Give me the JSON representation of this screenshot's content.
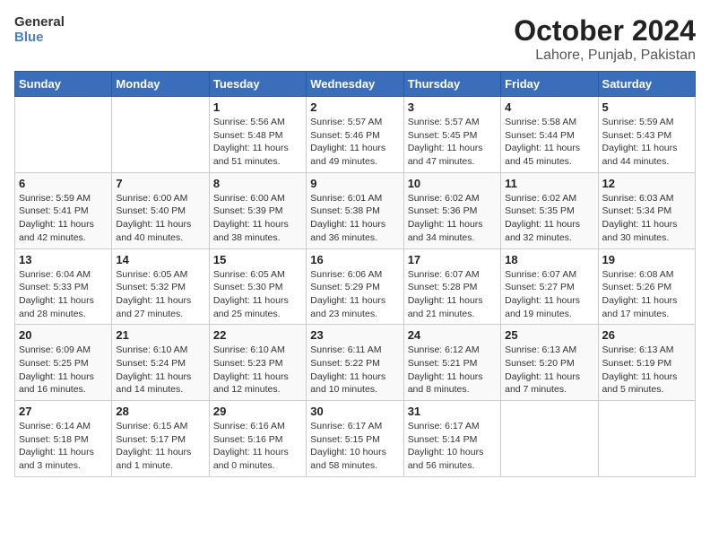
{
  "header": {
    "logo_line1": "General",
    "logo_line2": "Blue",
    "title": "October 2024",
    "subtitle": "Lahore, Punjab, Pakistan"
  },
  "weekdays": [
    "Sunday",
    "Monday",
    "Tuesday",
    "Wednesday",
    "Thursday",
    "Friday",
    "Saturday"
  ],
  "weeks": [
    [
      {
        "day": "",
        "info": ""
      },
      {
        "day": "",
        "info": ""
      },
      {
        "day": "1",
        "info": "Sunrise: 5:56 AM\nSunset: 5:48 PM\nDaylight: 11 hours and 51 minutes."
      },
      {
        "day": "2",
        "info": "Sunrise: 5:57 AM\nSunset: 5:46 PM\nDaylight: 11 hours and 49 minutes."
      },
      {
        "day": "3",
        "info": "Sunrise: 5:57 AM\nSunset: 5:45 PM\nDaylight: 11 hours and 47 minutes."
      },
      {
        "day": "4",
        "info": "Sunrise: 5:58 AM\nSunset: 5:44 PM\nDaylight: 11 hours and 45 minutes."
      },
      {
        "day": "5",
        "info": "Sunrise: 5:59 AM\nSunset: 5:43 PM\nDaylight: 11 hours and 44 minutes."
      }
    ],
    [
      {
        "day": "6",
        "info": "Sunrise: 5:59 AM\nSunset: 5:41 PM\nDaylight: 11 hours and 42 minutes."
      },
      {
        "day": "7",
        "info": "Sunrise: 6:00 AM\nSunset: 5:40 PM\nDaylight: 11 hours and 40 minutes."
      },
      {
        "day": "8",
        "info": "Sunrise: 6:00 AM\nSunset: 5:39 PM\nDaylight: 11 hours and 38 minutes."
      },
      {
        "day": "9",
        "info": "Sunrise: 6:01 AM\nSunset: 5:38 PM\nDaylight: 11 hours and 36 minutes."
      },
      {
        "day": "10",
        "info": "Sunrise: 6:02 AM\nSunset: 5:36 PM\nDaylight: 11 hours and 34 minutes."
      },
      {
        "day": "11",
        "info": "Sunrise: 6:02 AM\nSunset: 5:35 PM\nDaylight: 11 hours and 32 minutes."
      },
      {
        "day": "12",
        "info": "Sunrise: 6:03 AM\nSunset: 5:34 PM\nDaylight: 11 hours and 30 minutes."
      }
    ],
    [
      {
        "day": "13",
        "info": "Sunrise: 6:04 AM\nSunset: 5:33 PM\nDaylight: 11 hours and 28 minutes."
      },
      {
        "day": "14",
        "info": "Sunrise: 6:05 AM\nSunset: 5:32 PM\nDaylight: 11 hours and 27 minutes."
      },
      {
        "day": "15",
        "info": "Sunrise: 6:05 AM\nSunset: 5:30 PM\nDaylight: 11 hours and 25 minutes."
      },
      {
        "day": "16",
        "info": "Sunrise: 6:06 AM\nSunset: 5:29 PM\nDaylight: 11 hours and 23 minutes."
      },
      {
        "day": "17",
        "info": "Sunrise: 6:07 AM\nSunset: 5:28 PM\nDaylight: 11 hours and 21 minutes."
      },
      {
        "day": "18",
        "info": "Sunrise: 6:07 AM\nSunset: 5:27 PM\nDaylight: 11 hours and 19 minutes."
      },
      {
        "day": "19",
        "info": "Sunrise: 6:08 AM\nSunset: 5:26 PM\nDaylight: 11 hours and 17 minutes."
      }
    ],
    [
      {
        "day": "20",
        "info": "Sunrise: 6:09 AM\nSunset: 5:25 PM\nDaylight: 11 hours and 16 minutes."
      },
      {
        "day": "21",
        "info": "Sunrise: 6:10 AM\nSunset: 5:24 PM\nDaylight: 11 hours and 14 minutes."
      },
      {
        "day": "22",
        "info": "Sunrise: 6:10 AM\nSunset: 5:23 PM\nDaylight: 11 hours and 12 minutes."
      },
      {
        "day": "23",
        "info": "Sunrise: 6:11 AM\nSunset: 5:22 PM\nDaylight: 11 hours and 10 minutes."
      },
      {
        "day": "24",
        "info": "Sunrise: 6:12 AM\nSunset: 5:21 PM\nDaylight: 11 hours and 8 minutes."
      },
      {
        "day": "25",
        "info": "Sunrise: 6:13 AM\nSunset: 5:20 PM\nDaylight: 11 hours and 7 minutes."
      },
      {
        "day": "26",
        "info": "Sunrise: 6:13 AM\nSunset: 5:19 PM\nDaylight: 11 hours and 5 minutes."
      }
    ],
    [
      {
        "day": "27",
        "info": "Sunrise: 6:14 AM\nSunset: 5:18 PM\nDaylight: 11 hours and 3 minutes."
      },
      {
        "day": "28",
        "info": "Sunrise: 6:15 AM\nSunset: 5:17 PM\nDaylight: 11 hours and 1 minute."
      },
      {
        "day": "29",
        "info": "Sunrise: 6:16 AM\nSunset: 5:16 PM\nDaylight: 11 hours and 0 minutes."
      },
      {
        "day": "30",
        "info": "Sunrise: 6:17 AM\nSunset: 5:15 PM\nDaylight: 10 hours and 58 minutes."
      },
      {
        "day": "31",
        "info": "Sunrise: 6:17 AM\nSunset: 5:14 PM\nDaylight: 10 hours and 56 minutes."
      },
      {
        "day": "",
        "info": ""
      },
      {
        "day": "",
        "info": ""
      }
    ]
  ]
}
